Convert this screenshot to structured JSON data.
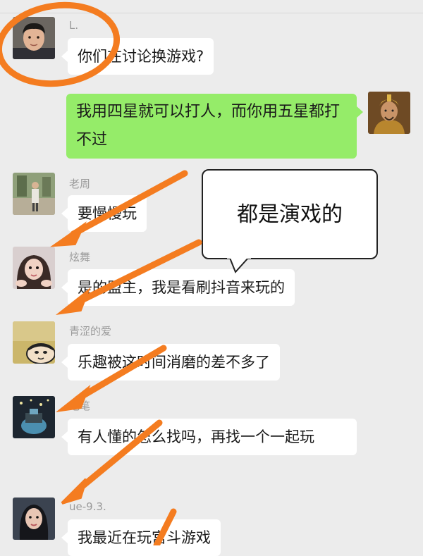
{
  "colors": {
    "background": "#ececec",
    "my_bubble": "#95ec69",
    "their_bubble": "#ffffff",
    "annotation": "#f47c20"
  },
  "messages": [
    {
      "sender": "L.",
      "text": "你们在讨论换游戏?",
      "avatar": "boy-avatar"
    },
    {
      "sender": "",
      "text": "我用四星就可以打人，而你用五星都打不过",
      "avatar": "warrior-avatar",
      "outgoing": true
    },
    {
      "sender": "老周",
      "text": "要慢慢玩",
      "avatar": "outdoor-person-avatar"
    },
    {
      "sender": "炫舞",
      "text": "是的盟主，我是看刷抖音来玩的",
      "avatar": "girl-avatar"
    },
    {
      "sender": "青涩的爱",
      "text": "乐趣被这时间消磨的差不多了",
      "avatar": "cartoon-avatar"
    },
    {
      "sender": "毛笔",
      "text": "有人懂的怎么找吗，再找一个一起玩",
      "avatar": "night-scene-avatar"
    },
    {
      "sender": "ue-9.3.",
      "text": "我最近在玩宫斗游戏",
      "avatar": "woman-avatar"
    }
  ],
  "annotation": {
    "callout_text": "都是演戏的"
  }
}
